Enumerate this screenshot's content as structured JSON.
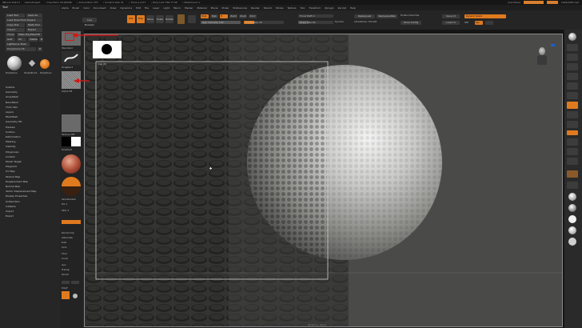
{
  "titlebar": {
    "app": "ZBrush 2021.5",
    "project": "DemoProject",
    "stats": [
      "• Free Mem 18.283GB",
      "• Active Mem 375",
      "• Scratch Disk 31",
      "• Timer ▸ 0.07",
      "• Polycount 766.77 KP",
      "• MeshCount 1"
    ],
    "quicksave": "QuickSave",
    "see_through": "See-through  0",
    "menus_label": "Menus",
    "script_label": "DefaultZScript"
  },
  "menubar": [
    "Alpha",
    "Brush",
    "Color",
    "Document",
    "Draw",
    "Dynamics",
    "Edit",
    "File",
    "Layer",
    "Light",
    "Macro",
    "Marker",
    "Material",
    "Movie",
    "Picker",
    "Preferences",
    "Render",
    "Stencil",
    "Stroke",
    "Texture",
    "Tool",
    "Transform",
    "Zplugin",
    "Zscript",
    "Help"
  ],
  "topshelf": {
    "lightbox": "LightBox",
    "live_boolean": "Live Boolean",
    "edit": "Edit",
    "draw": "Draw",
    "move": "Move",
    "scale": "Scale",
    "rotate": "Rotate",
    "mrgb": "Mrgb",
    "rgb": "Rgb",
    "m": "M",
    "zadd": "Zadd",
    "zsub": "Zsub",
    "zcut": "Zcut",
    "rgb_intensity": "Rgb Intensity 100",
    "z_intensity": "Z Intensity 25",
    "focal_shift": "Focal Shift 0",
    "draw_size": "Draw Size 64",
    "dynamic": "Dynamic",
    "active_points": "ActivePoints: 767,093",
    "total_points": "TotalPoints: 248,070",
    "replay_last": "ReplayLast",
    "replay_last_rel": "ReplayLastRel",
    "enable_customize": "Enable Customize",
    "store_config": "Store Config",
    "save_ui": "Save UI",
    "load_ui": "Load UI",
    "dynamic_subdiv": "Dynamic Subdiv",
    "smt": "SMt",
    "res": "Res",
    "doc_label": "Doc"
  },
  "toolpanel": {
    "title": "Tool",
    "buttons": {
      "load_tool": "Load Tool",
      "save_as": "Save As",
      "load_tools_from_project": "Load Tools From Project",
      "copy_tool": "Copy Tool",
      "paste_tool": "Paste Tool",
      "import": "Import",
      "export": "Export",
      "clone": "Clone",
      "make_polymesh3d": "Make PolyMesh3D",
      "goz": "GoZ",
      "all": "All",
      "visible": "Visible",
      "r": "R",
      "lightbox_tools": "Lightbox ▸ Tools",
      "polysphere_slider": "PolySphere 48",
      "r2": "R"
    },
    "thumbs": [
      "PolySphere",
      "SimpleBrush",
      "PolySphere"
    ],
    "menu": [
      "Subtool",
      "Geometry",
      "ArrayMesh",
      "NanoMesh",
      "Thick Skin",
      "Layers",
      "FiberMesh",
      "Geometry HD",
      "Preview",
      "Surface",
      "Deformation",
      "Masking",
      "Visibility",
      "Polygroups",
      "Contact",
      "Morph Target",
      "Polypaint",
      "UV Map",
      "Texture Map",
      "Displacement Map",
      "Normal Map",
      "Vector Displacement Map",
      "Display Properties",
      "Unified Skin",
      "Initialize",
      "Import",
      "Export"
    ]
  },
  "leftshelf": {
    "texture_off": "Texture Off",
    "gradient": "Gradient",
    "switch_color": "SwitchColor",
    "material_label": "Material",
    "alternate": "Alternate",
    "spix": "SPix 3",
    "zero_comp": "ZeroComp",
    "edit_label": "Edit",
    "solo": "Solo",
    "actual": "Actual",
    "aahalf": "AAHalf",
    "dynamic_persp": "Dynamic Persp",
    "floor": "Floor",
    "local": "Local",
    "xyz": "Xyz",
    "frame": "Frame",
    "move": "Move",
    "scale": "Scale",
    "transp": "Transp",
    "ghost": "Ghost",
    "line_fill": "Line Fill",
    "polyf": "PolyF",
    "brush_label": "Standard",
    "stroke_label": "DragRect",
    "alpha_label": "Alpha 58",
    "texture_label": "Texture Off",
    "material_name": "SkinShade4",
    "mat_label": "MatCap Gray",
    "pix_label": "Pix 1"
  },
  "canvas": {
    "crop_label": "Crop (H)",
    "bottom_label": "Rendering • Stencil"
  },
  "colors": {
    "accent": "#e07a1e",
    "panel": "#262626",
    "canvas": "#4a4a48",
    "frame": "#d0d0d0"
  },
  "icons": [
    "head-navigation-icon",
    "sphere-material-icon",
    "gear-icon",
    "arrow-indicator-icon"
  ]
}
